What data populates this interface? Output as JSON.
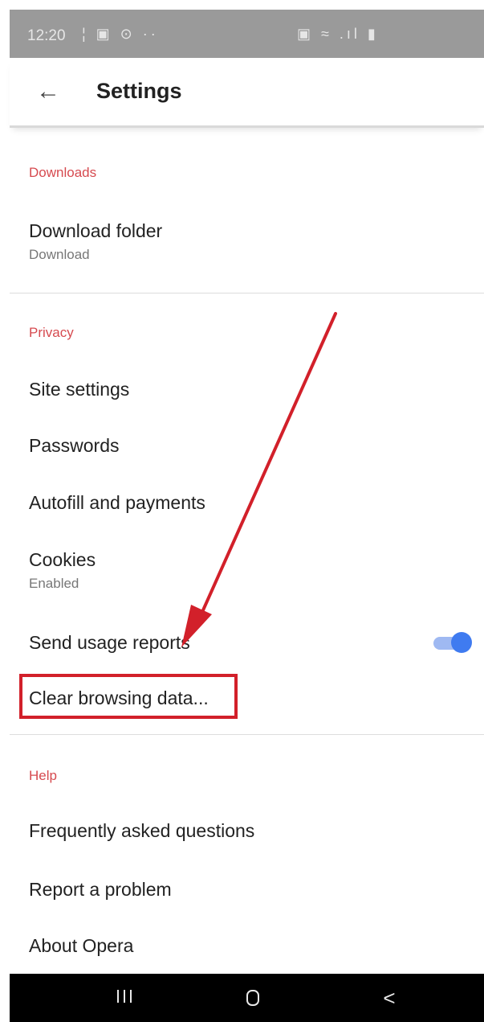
{
  "status_bar": {
    "time": "12:20",
    "icons_left": "¦ ▣ ⊙ ··",
    "icons_right": "▣ ≈ .ıl ▮"
  },
  "app_bar": {
    "back_icon": "arrow-back-icon",
    "title": "Settings"
  },
  "sections": {
    "downloads": {
      "header": "Downloads",
      "download_folder": {
        "title": "Download folder",
        "subtitle": "Download"
      }
    },
    "privacy": {
      "header": "Privacy",
      "site_settings": "Site settings",
      "passwords": "Passwords",
      "autofill": "Autofill and payments",
      "cookies": {
        "title": "Cookies",
        "subtitle": "Enabled"
      },
      "usage_reports": {
        "title": "Send usage reports",
        "enabled": true
      },
      "clear_browsing": "Clear browsing data..."
    },
    "help": {
      "header": "Help",
      "faq": "Frequently asked questions",
      "report": "Report a problem",
      "about": "About Opera"
    }
  },
  "colors": {
    "section_header": "#d64a4f",
    "toggle_on": "#3f7bf0",
    "annotation": "#d2202a"
  },
  "nav_bar": {
    "recents_icon": "recents-icon",
    "home_icon": "home-icon",
    "back_icon": "back-icon",
    "back_glyph": "<"
  }
}
